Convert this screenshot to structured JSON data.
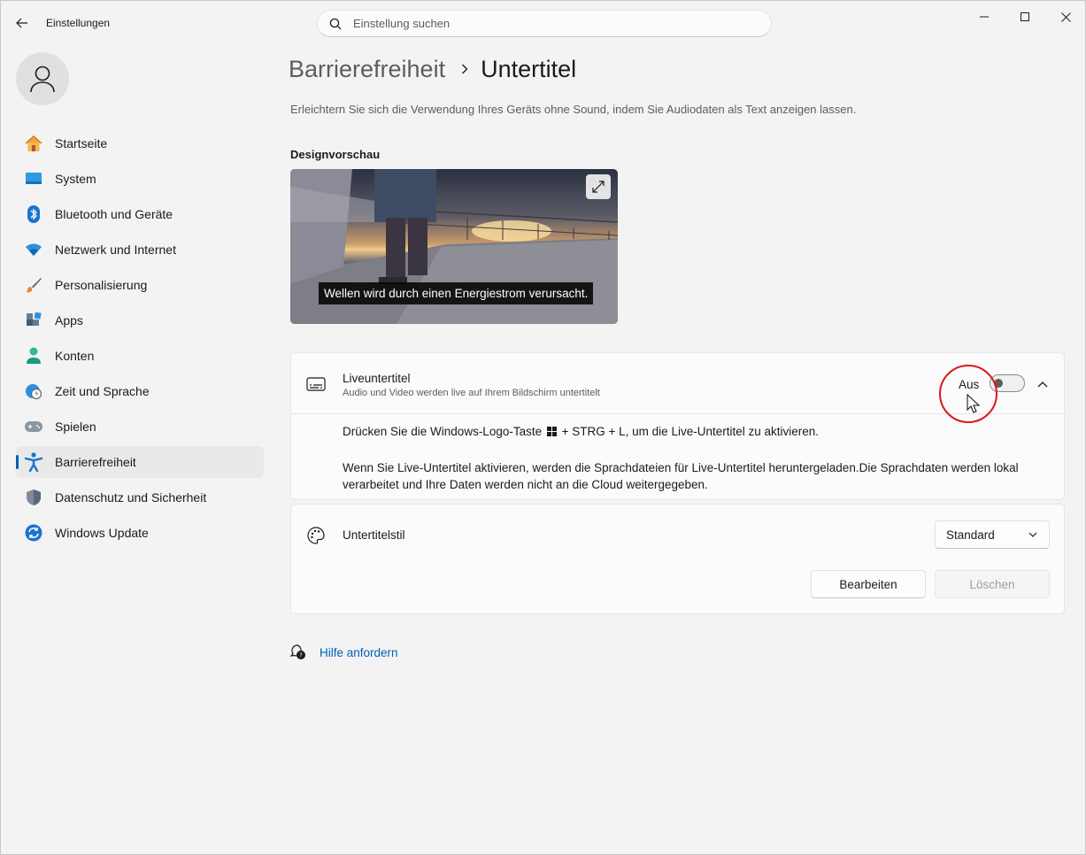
{
  "window": {
    "title": "Einstellungen",
    "search_placeholder": "Einstellung suchen"
  },
  "sidebar": {
    "items": [
      {
        "label": "Startseite",
        "icon": "home-icon"
      },
      {
        "label": "System",
        "icon": "system-icon"
      },
      {
        "label": "Bluetooth und Geräte",
        "icon": "bluetooth-icon"
      },
      {
        "label": "Netzwerk und Internet",
        "icon": "wifi-icon"
      },
      {
        "label": "Personalisierung",
        "icon": "brush-icon"
      },
      {
        "label": "Apps",
        "icon": "apps-icon"
      },
      {
        "label": "Konten",
        "icon": "accounts-icon"
      },
      {
        "label": "Zeit und Sprache",
        "icon": "globe-clock-icon"
      },
      {
        "label": "Spielen",
        "icon": "gamepad-icon"
      },
      {
        "label": "Barrierefreiheit",
        "icon": "accessibility-icon",
        "active": true
      },
      {
        "label": "Datenschutz und Sicherheit",
        "icon": "shield-icon"
      },
      {
        "label": "Windows Update",
        "icon": "update-icon"
      }
    ]
  },
  "main": {
    "breadcrumb_parent": "Barrierefreiheit",
    "breadcrumb_current": "Untertitel",
    "subtitle": "Erleichtern Sie sich die Verwendung Ihres Geräts ohne Sound, indem Sie Audiodaten als Text anzeigen lassen.",
    "preview_title": "Designvorschau",
    "preview_caption": "Wellen wird durch einen Energiestrom verursacht.",
    "live": {
      "title": "Liveuntertitel",
      "description": "Audio und Video werden live auf Ihrem Bildschirm untertitelt",
      "toggle_state": "Aus",
      "shortcut_prefix": "Drücken Sie die Windows-Logo-Taste",
      "shortcut_suffix": "+ STRG + L, um die Live-Untertitel zu aktivieren.",
      "info": "Wenn Sie Live-Untertitel aktivieren, werden die Sprachdateien für Live-Untertitel heruntergeladen.Die Sprachdaten werden lokal verarbeitet und Ihre Daten werden nicht an die Cloud weitergegeben."
    },
    "style": {
      "title": "Untertitelstil",
      "selected": "Standard",
      "edit_label": "Bearbeiten",
      "delete_label": "Löschen"
    },
    "help_label": "Hilfe anfordern"
  },
  "colors": {
    "accent": "#005fb8",
    "highlight": "#e0141e"
  }
}
